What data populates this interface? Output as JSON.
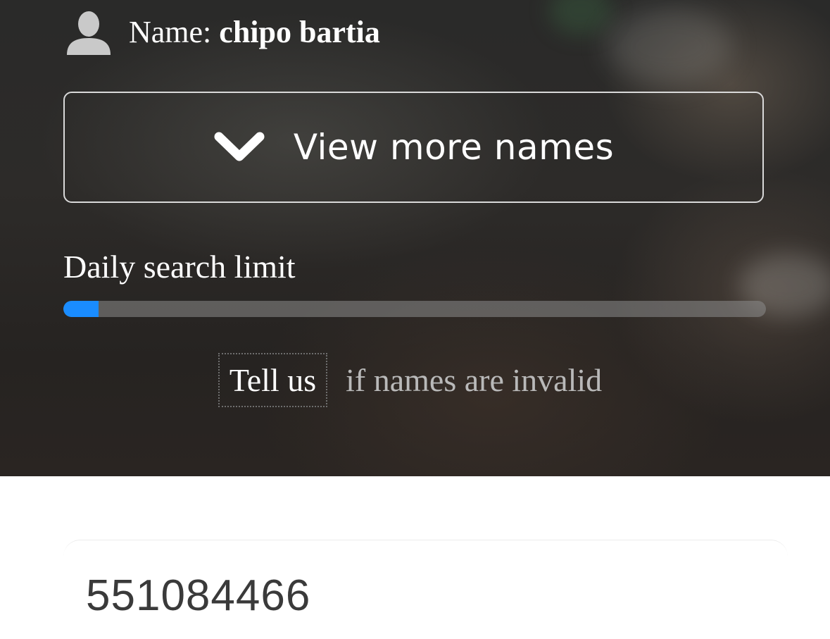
{
  "user": {
    "label": "Name: ",
    "name": "chipo bartia",
    "icon": "user-silhouette-icon"
  },
  "view_more": {
    "label": "View more names",
    "icon": "chevron-down-icon"
  },
  "search_limit": {
    "label": "Daily search limit",
    "progress_fraction": 0.05,
    "fill_color": "#1a8cff"
  },
  "report": {
    "link_label": "Tell us",
    "text": "if names are invalid"
  },
  "number_card": {
    "value": "551084466"
  }
}
